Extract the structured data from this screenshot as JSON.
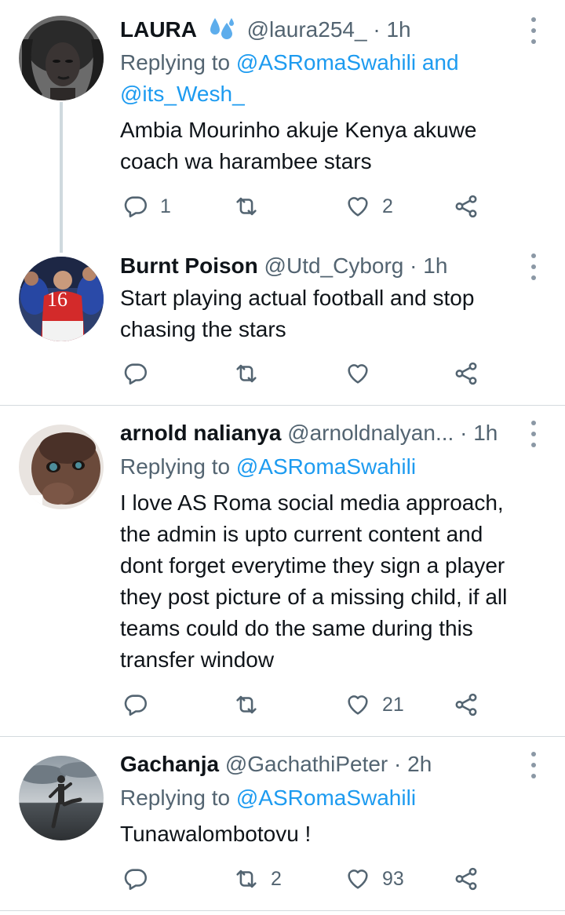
{
  "colors": {
    "text": "#0f1419",
    "muted": "#536471",
    "link": "#1d9bf0",
    "divider": "#d4dade"
  },
  "tweets": [
    {
      "name": "LAURA",
      "badge": "droplets-emoji",
      "handle": "@laura254_",
      "dot": "·",
      "time": "1h",
      "replying": {
        "prefix": "Replying to",
        "line1": "@ASRomaSwahili and",
        "line2": "@its_Wesh_"
      },
      "text_lines": [
        "Ambia Mourinho akuje Kenya akuwe",
        "coach wa harambee stars"
      ],
      "counts": {
        "replies": "1",
        "retweets": "",
        "likes": "2"
      }
    },
    {
      "name": "Burnt Poison",
      "handle": "@Utd_Cyborg",
      "dot": "·",
      "time": "1h",
      "text_lines": [
        "Start playing actual football and stop",
        "chasing the stars"
      ],
      "counts": {
        "replies": "",
        "retweets": "",
        "likes": ""
      },
      "avatar_jersey": "16"
    },
    {
      "name": "arnold nalianya",
      "handle": "@arnoldnalyan...",
      "dot": "·",
      "time": "1h",
      "replying": {
        "prefix": "Replying to",
        "line1": "@ASRomaSwahili"
      },
      "text_lines": [
        "I love AS Roma social media approach,",
        "the admin is upto current content and",
        "dont forget everytime they sign a player",
        "they post picture of a missing child, if all",
        "teams could do the same during this",
        "transfer window"
      ],
      "counts": {
        "replies": "",
        "retweets": "",
        "likes": "21"
      }
    },
    {
      "name": "Gachanja",
      "handle": "@GachathiPeter",
      "dot": "·",
      "time": "2h",
      "replying": {
        "prefix": "Replying to",
        "line1": "@ASRomaSwahili"
      },
      "text_lines": [
        "Tunawalombotovu !"
      ],
      "counts": {
        "replies": "",
        "retweets": "2",
        "likes": "93"
      }
    }
  ]
}
